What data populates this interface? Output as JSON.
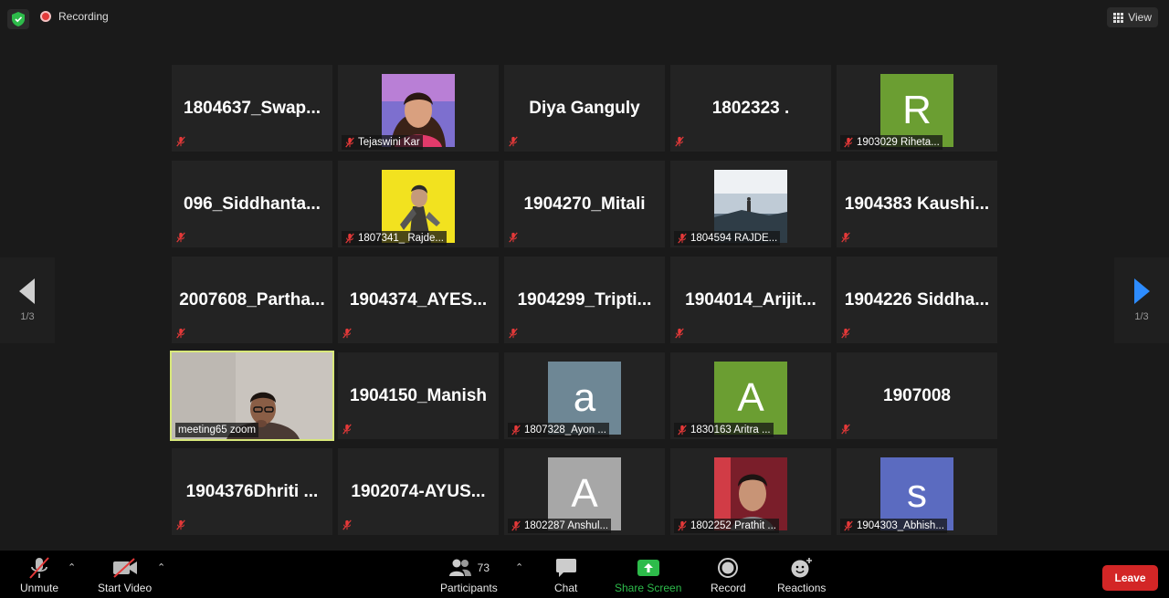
{
  "topbar": {
    "recording": "Recording",
    "view": "View"
  },
  "nav": {
    "left_page": "1/3",
    "right_page": "1/3"
  },
  "tiles": [
    {
      "name": "1804637_Swap..."
    },
    {
      "label": "Tejaswini Kar",
      "photo": "woman-photo"
    },
    {
      "name": "Diya Ganguly"
    },
    {
      "name": "1802323 ."
    },
    {
      "label": "1903029 Riheta...",
      "avatar_letter": "R",
      "avatar_color": "#6b9e32"
    },
    {
      "name": "096_Siddhanta..."
    },
    {
      "label": "1807341_ Rajde...",
      "photo": "game-character-photo"
    },
    {
      "name": "1904270_Mitali"
    },
    {
      "label": "1804594 RAJDE...",
      "photo": "lake-photo"
    },
    {
      "name": "1904383  Kaushi..."
    },
    {
      "name": "2007608_Partha..."
    },
    {
      "name": "1904374_AYES..."
    },
    {
      "name": "1904299_Tripti..."
    },
    {
      "name": "1904014_Arijit..."
    },
    {
      "name": "1904226  Siddha..."
    },
    {
      "label": "meeting65 zoom",
      "video": true
    },
    {
      "name": "1904150_Manish"
    },
    {
      "label": "1807328_Ayon ...",
      "avatar_letter": "a",
      "avatar_color": "#6e8795"
    },
    {
      "label": "1830163 Aritra ...",
      "avatar_letter": "A",
      "avatar_color": "#6b9e32"
    },
    {
      "name": "1907008"
    },
    {
      "name": "1904376Dhriti ..."
    },
    {
      "name": "1902074-AYUS..."
    },
    {
      "label": "1802287 Anshul...",
      "avatar_letter": "A",
      "avatar_color": "#a7a7a7"
    },
    {
      "label": "1802252 Prathit ...",
      "photo": "man-photo"
    },
    {
      "label": "1904303_Abhish...",
      "avatar_letter": "s",
      "avatar_color": "#5b6bc0"
    }
  ],
  "toolbar": {
    "unmute": "Unmute",
    "start_video": "Start Video",
    "participants": "Participants",
    "participants_count": "73",
    "chat": "Chat",
    "share_screen": "Share Screen",
    "record": "Record",
    "reactions": "Reactions",
    "leave": "Leave"
  },
  "colors": {
    "share_green": "#2dbb4a",
    "leave_red": "#d32626",
    "active_border": "#d8e87a",
    "nav_arrow_active": "#2d8cff"
  }
}
